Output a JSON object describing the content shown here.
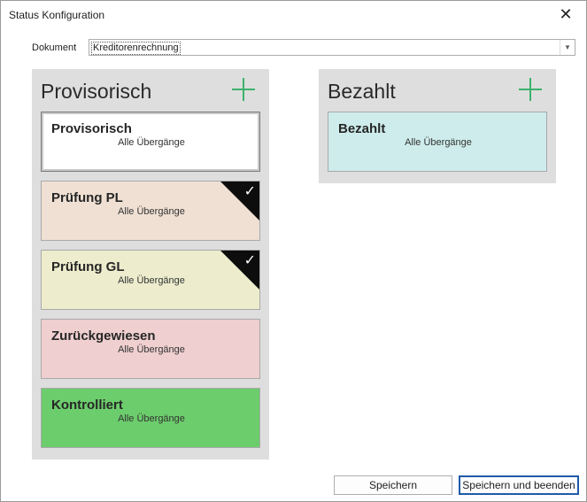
{
  "window": {
    "title": "Status Konfiguration"
  },
  "document": {
    "label": "Dokument",
    "value": "Kreditorenrechnung"
  },
  "columns": [
    {
      "title": "Provisorisch",
      "cards": [
        {
          "title": "Provisorisch",
          "subtitle": "Alle Übergänge",
          "color": "#ffffff",
          "checked": false,
          "selected": true
        },
        {
          "title": "Prüfung PL",
          "subtitle": "Alle Übergänge",
          "color": "#efe0d3",
          "checked": true,
          "selected": false
        },
        {
          "title": "Prüfung GL",
          "subtitle": "Alle Übergänge",
          "color": "#ededce",
          "checked": true,
          "selected": false
        },
        {
          "title": "Zurückgewiesen",
          "subtitle": "Alle Übergänge",
          "color": "#efcfcf",
          "checked": false,
          "selected": false
        },
        {
          "title": "Kontrolliert",
          "subtitle": "Alle Übergänge",
          "color": "#6ccd6c",
          "checked": false,
          "selected": false
        }
      ]
    },
    {
      "title": "Bezahlt",
      "cards": [
        {
          "title": "Bezahlt",
          "subtitle": "Alle Übergänge",
          "color": "#cdeceb",
          "checked": false,
          "selected": false
        }
      ]
    }
  ],
  "buttons": {
    "save": "Speichern",
    "save_close": "Speichern und beenden"
  },
  "icons": {
    "close": "close-icon",
    "add": "plus-icon",
    "check": "checkmark-icon",
    "dropdown": "chevron-down-icon"
  },
  "colors": {
    "accent_plus": "#3cb26b",
    "column_bg": "#dedede"
  }
}
